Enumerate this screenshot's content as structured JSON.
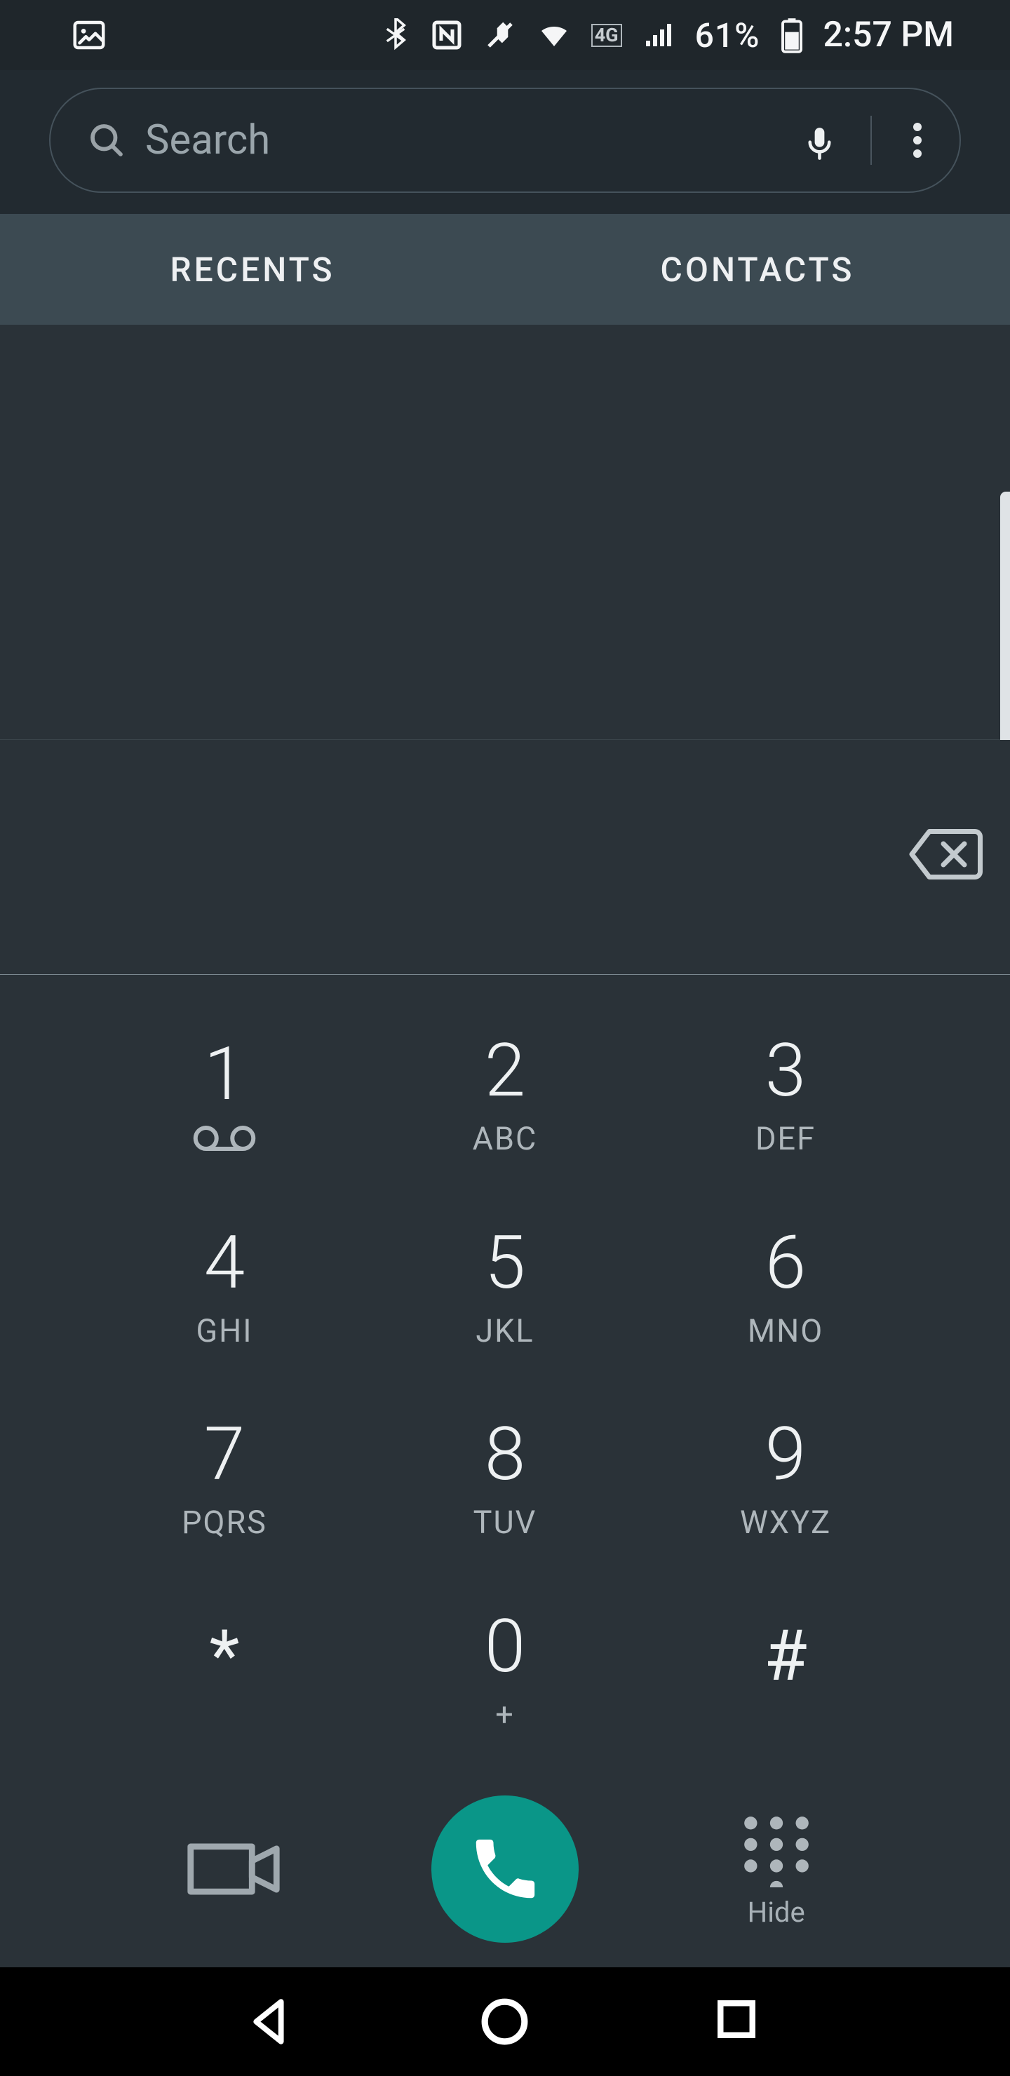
{
  "status": {
    "battery_pct": "61%",
    "time": "2:57 PM",
    "network_label": "4G"
  },
  "search": {
    "placeholder": "Search"
  },
  "tabs": [
    {
      "label": "RECENTS"
    },
    {
      "label": "CONTACTS"
    }
  ],
  "entry": {
    "value": ""
  },
  "dialpad": [
    {
      "digit": "1",
      "sub_icon": "voicemail"
    },
    {
      "digit": "2",
      "sub": "ABC"
    },
    {
      "digit": "3",
      "sub": "DEF"
    },
    {
      "digit": "4",
      "sub": "GHI"
    },
    {
      "digit": "5",
      "sub": "JKL"
    },
    {
      "digit": "6",
      "sub": "MNO"
    },
    {
      "digit": "7",
      "sub": "PQRS"
    },
    {
      "digit": "8",
      "sub": "TUV"
    },
    {
      "digit": "9",
      "sub": "WXYZ"
    },
    {
      "digit": "*",
      "symbol": true
    },
    {
      "digit": "0",
      "sub": "+"
    },
    {
      "digit": "#",
      "symbol": true
    }
  ],
  "actions": {
    "hide_label": "Hide"
  },
  "colors": {
    "bg": "#2a3238",
    "tab_bg": "#3c4a52",
    "accent": "#0a9688"
  }
}
